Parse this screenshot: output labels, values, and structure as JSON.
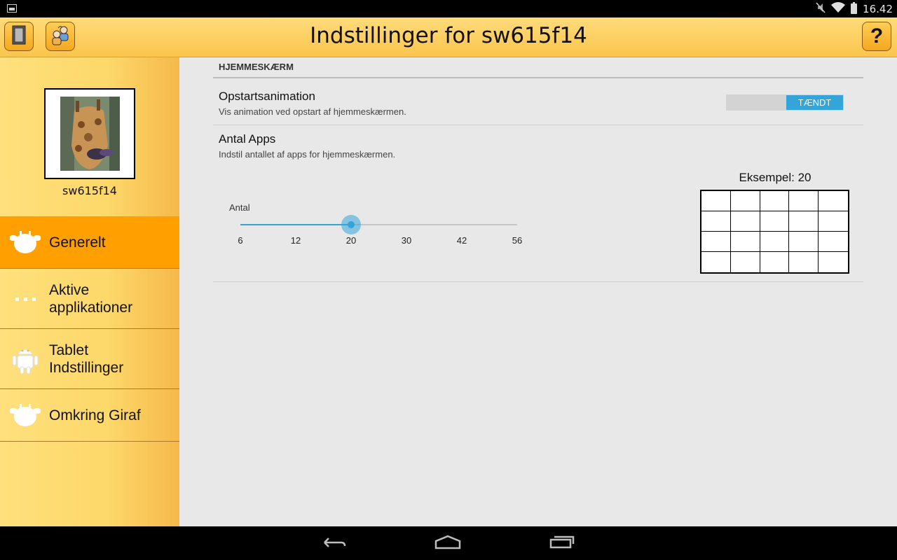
{
  "status_bar": {
    "time": "16.42",
    "icons": [
      "image-icon",
      "mute-icon",
      "wifi-icon",
      "battery-icon"
    ]
  },
  "action_bar": {
    "title": "Indstillinger for sw615f14",
    "help_label": "?",
    "left_buttons": [
      "exit-door-icon",
      "switch-user-icon"
    ]
  },
  "sidebar": {
    "profile_name": "sw615f14",
    "items": [
      {
        "label": "Generelt",
        "icon": "giraffe-head-icon",
        "active": true
      },
      {
        "label": "Aktive applikationer",
        "icon": "dots-icon",
        "active": false
      },
      {
        "label": "Tablet Indstillinger",
        "icon": "android-icon",
        "active": false
      },
      {
        "label": "Omkring Giraf",
        "icon": "giraffe-head-icon",
        "active": false
      }
    ]
  },
  "content": {
    "section_header": "HJEMMESKÆRM",
    "startup": {
      "title": "Opstartsanimation",
      "summary": "Vis animation ved opstart af hjemmeskærmen.",
      "toggle_label": "TÆNDT",
      "enabled": true
    },
    "apps": {
      "title": "Antal Apps",
      "summary": "Indstil antallet af apps for hjemmeskærmen.",
      "slider_label": "Antal",
      "slider_min": 6,
      "slider_max": 56,
      "slider_value": 20,
      "ticks": [
        "6",
        "12",
        "20",
        "30",
        "42",
        "56"
      ],
      "example_label": "Eksempel: 20",
      "grid_columns": 5,
      "grid_rows": 4
    }
  },
  "colors": {
    "accent": "#33a5d8",
    "active_menu": "#ffa000",
    "action_bar": "#fbc54d"
  }
}
